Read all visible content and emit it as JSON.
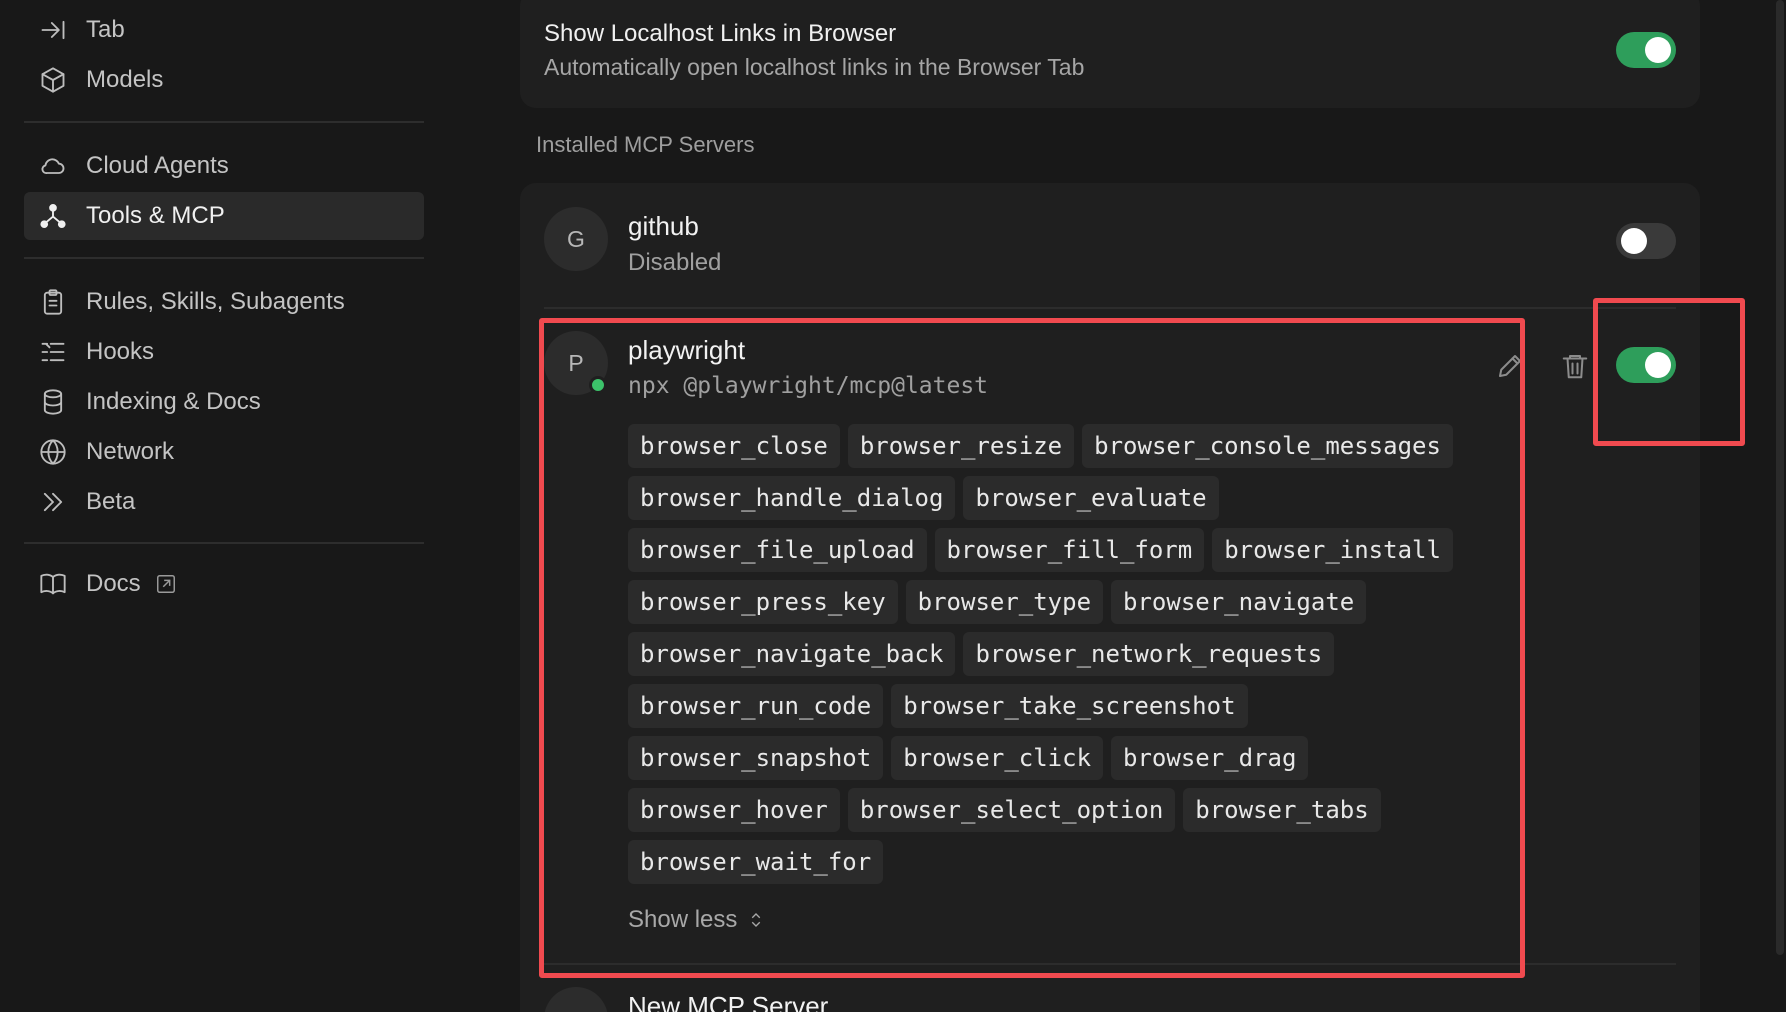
{
  "sidebar": {
    "items": [
      {
        "label": "Tab",
        "icon": "tab-arrow-icon"
      },
      {
        "label": "Models",
        "icon": "cube-icon"
      },
      {
        "label": "Cloud Agents",
        "icon": "cloud-icon"
      },
      {
        "label": "Tools & MCP",
        "icon": "tools-nodes-icon",
        "active": true
      },
      {
        "label": "Rules, Skills, Subagents",
        "icon": "clipboard-icon"
      },
      {
        "label": "Hooks",
        "icon": "hooks-list-icon"
      },
      {
        "label": "Indexing & Docs",
        "icon": "database-icon"
      },
      {
        "label": "Network",
        "icon": "globe-icon"
      },
      {
        "label": "Beta",
        "icon": "chevrons-icon"
      },
      {
        "label": "Docs",
        "icon": "book-icon"
      }
    ]
  },
  "settings": {
    "localhost": {
      "title": "Show Localhost Links in Browser",
      "description": "Automatically open localhost links in the Browser Tab",
      "enabled": true
    }
  },
  "section_label": "Installed MCP Servers",
  "servers": [
    {
      "initial": "G",
      "name": "github",
      "subtitle": "Disabled",
      "enabled": false
    },
    {
      "initial": "P",
      "name": "playwright",
      "subtitle": "npx @playwright/mcp@latest",
      "enabled": true,
      "tools": [
        "browser_close",
        "browser_resize",
        "browser_console_messages",
        "browser_handle_dialog",
        "browser_evaluate",
        "browser_file_upload",
        "browser_fill_form",
        "browser_install",
        "browser_press_key",
        "browser_type",
        "browser_navigate",
        "browser_navigate_back",
        "browser_network_requests",
        "browser_run_code",
        "browser_take_screenshot",
        "browser_snapshot",
        "browser_click",
        "browser_drag",
        "browser_hover",
        "browser_select_option",
        "browser_tabs",
        "browser_wait_for"
      ],
      "show_less_label": "Show less"
    }
  ],
  "new_server": {
    "label": "New MCP Server"
  },
  "colors": {
    "accent_green": "#2e9e5b",
    "status_green": "#3cc26a",
    "highlight_red": "#f04a4f"
  }
}
